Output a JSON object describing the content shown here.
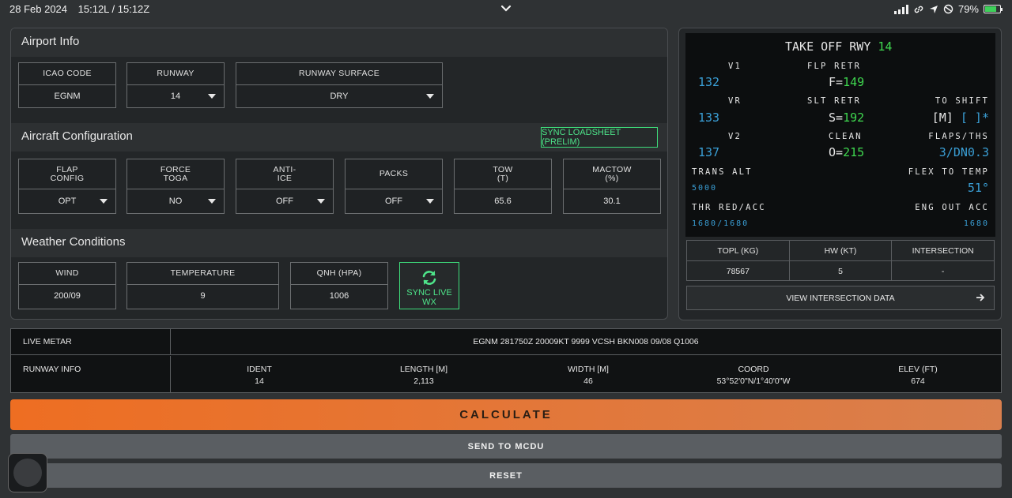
{
  "status_bar": {
    "date": "28 Feb 2024",
    "time": "15:12L / 15:12Z",
    "battery": "79%",
    "battery_level": 0.79,
    "icons": [
      "chevron-down-icon",
      "signal-icon",
      "link-icon",
      "location-icon",
      "do-not-disturb-icon",
      "battery-icon"
    ]
  },
  "airport": {
    "title": "Airport Info",
    "icao_label": "ICAO CODE",
    "icao_value": "EGNM",
    "runway_label": "RUNWAY",
    "runway_value": "14",
    "surface_label": "RUNWAY SURFACE",
    "surface_value": "DRY"
  },
  "config": {
    "title": "Aircraft Configuration",
    "sync_loadsheet": "SYNC LOADSHEET (PRELIM)",
    "flap_label": "FLAP\nCONFIG",
    "flap_value": "OPT",
    "toga_label": "FORCE\nTOGA",
    "toga_value": "NO",
    "anti_ice_label": "ANTI-\nICE",
    "anti_ice_value": "OFF",
    "packs_label": "PACKS",
    "packs_value": "OFF",
    "tow_label": "TOW\n(T)",
    "tow_value": "65.6",
    "mactow_label": "MACTOW\n(%)",
    "mactow_value": "30.1"
  },
  "weather": {
    "title": "Weather Conditions",
    "wind_label": "WIND",
    "wind_value": "200/09",
    "temp_label": "TEMPERATURE",
    "temp_value": "9",
    "qnh_label": "QNH (HPA)",
    "qnh_value": "1006",
    "sync_live_wx": "SYNC LIVE WX"
  },
  "mcdu": {
    "title": "TAKE OFF RWY",
    "title_rwy": "14",
    "v1_label": "V1",
    "v1_value": "132",
    "vr_label": "VR",
    "vr_value": "133",
    "v2_label": "V2",
    "v2_value": "137",
    "flp_retr_label": "FLP RETR",
    "flp_retr_prefix": "F=",
    "flp_retr_value": "149",
    "slt_retr_label": "SLT RETR",
    "slt_retr_prefix": "S=",
    "slt_retr_value": "192",
    "clean_label": "CLEAN",
    "clean_prefix": "O=",
    "clean_value": "215",
    "to_shift_label": "TO SHIFT",
    "to_shift_unit": "[M]",
    "to_shift_value": "[ ]*",
    "flaps_ths_label": "FLAPS/THS",
    "flaps_ths_value": "3/DN0.3",
    "trans_alt_label": "TRANS ALT",
    "trans_alt_value": "5000",
    "flex_temp_label": "FLEX TO TEMP",
    "flex_temp_value": "51°",
    "thr_red_label": "THR RED/ACC",
    "thr_red_value": "1680/1680",
    "eng_out_label": "ENG OUT ACC",
    "eng_out_value": "1680"
  },
  "results": {
    "topl_label": "TOPL (KG)",
    "topl_value": "78567",
    "hw_label": "HW (KT)",
    "hw_value": "5",
    "intersection_label": "INTERSECTION",
    "intersection_value": "-",
    "view_intersection": "VIEW INTERSECTION DATA"
  },
  "info": {
    "metar_label": "LIVE METAR",
    "metar_value": "EGNM 281750Z 20009KT 9999 VCSH BKN008 09/08 Q1006",
    "runway_info_label": "RUNWAY INFO",
    "ident_label": "IDENT",
    "ident_value": "14",
    "length_label": "LENGTH [M]",
    "length_value": "2,113",
    "width_label": "WIDTH [M]",
    "width_value": "46",
    "coord_label": "COORD",
    "coord_value": "53°52'0\"N/1°40'0\"W",
    "elev_label": "ELEV (FT)",
    "elev_value": "674"
  },
  "actions": {
    "calculate": "CALCULATE",
    "send_mcdu": "SEND TO MCDU",
    "reset": "RESET"
  },
  "colors": {
    "accent_orange": "#ee6e22",
    "sync_green": "#3edc7a",
    "mcdu_green": "#3fd74f",
    "mcdu_cyan": "#3a9fd6"
  }
}
